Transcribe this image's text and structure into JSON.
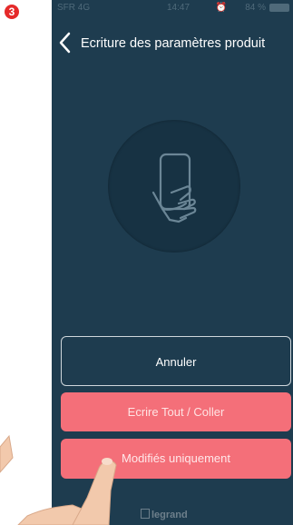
{
  "step_badge": "3",
  "status_bar": {
    "carrier": "SFR 4G",
    "time": "14:47",
    "battery": "84 %",
    "icons": [
      "signal-icon",
      "alarm-icon",
      "battery-icon"
    ]
  },
  "nav": {
    "title": "Ecriture des paramètres produit",
    "back_icon": "chevron-left-icon"
  },
  "illustration": {
    "icon": "hand-holding-phone-icon"
  },
  "buttons": {
    "cancel_label": "Annuler",
    "write_all_label": "Ecrire Tout / Coller",
    "modified_only_label": "Modifiés uniquement"
  },
  "brand": {
    "name": "legrand"
  },
  "colors": {
    "background": "#1e3c4f",
    "button_red": "#f46f79",
    "badge_red": "#e52a2a"
  }
}
